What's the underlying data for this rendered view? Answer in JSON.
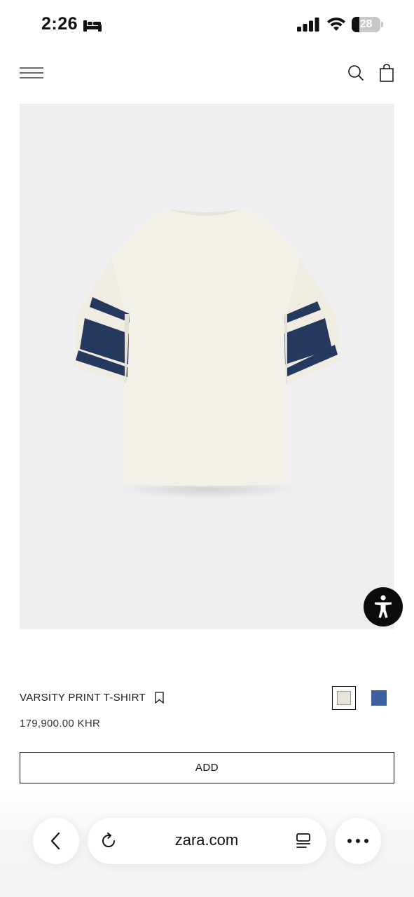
{
  "status_bar": {
    "time": "2:26",
    "battery_percent": 28,
    "battery_label": "28",
    "icons": [
      "sleep-icon",
      "cellular-signal-icon",
      "wifi-icon",
      "battery-icon"
    ]
  },
  "header": {
    "icons": [
      "menu-icon",
      "search-icon",
      "shopping-bag-icon"
    ]
  },
  "product": {
    "image_description": "cream t-shirt back view with navy striped sleeves",
    "name": "VARSITY PRINT T-SHIRT",
    "price": "179,900.00 KHR",
    "add_label": "ADD",
    "colors": [
      {
        "name": "cream",
        "hex": "#e8e4d8",
        "selected": true
      },
      {
        "name": "blue",
        "hex": "#3d5fa3",
        "selected": false
      }
    ]
  },
  "accessibility": {
    "icon": "accessibility-icon"
  },
  "browser": {
    "url": "zara.com",
    "icons": [
      "back-chevron-icon",
      "reload-icon",
      "reader-icon",
      "more-icon"
    ]
  },
  "colors": {
    "navy_stripe": "#24365b",
    "shirt": "#f2efe6",
    "image_bg": "#efeff1"
  }
}
